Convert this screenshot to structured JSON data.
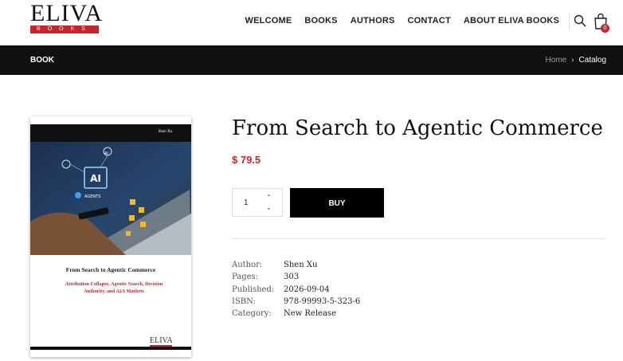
{
  "logo": {
    "main": "ELIVA",
    "sub": "BOOKS"
  },
  "nav": [
    "WELCOME",
    "BOOKS",
    "AUTHORS",
    "CONTACT",
    "ABOUT ELIVA BOOKS"
  ],
  "cart": {
    "count": "0"
  },
  "bar": {
    "title": "BOOK",
    "crumbs": [
      "Home",
      "Catalog"
    ]
  },
  "cover": {
    "author": "Shen Xu",
    "title": "From Search to Agentic Commerce",
    "subtitle": "Attribution Collapse, Agentic Search, Decision Authority, and A2A Markets",
    "ai_label": "AI",
    "agents_label": "AGENTS",
    "publisher": "ELIVA"
  },
  "product": {
    "title": "From Search to Agentic Commerce",
    "price": "$ 79.5",
    "quantity": "1",
    "buy_label": "BUY"
  },
  "details": [
    {
      "label": "Author:",
      "value": "Shen Xu"
    },
    {
      "label": "Pages:",
      "value": "303"
    },
    {
      "label": "Published:",
      "value": "2026-09-04"
    },
    {
      "label": "ISBN:",
      "value": "978-99993-5-323-6"
    },
    {
      "label": "Category:",
      "value": "New Release"
    }
  ],
  "colors": {
    "accent": "#c4262e",
    "bar": "#111111"
  }
}
